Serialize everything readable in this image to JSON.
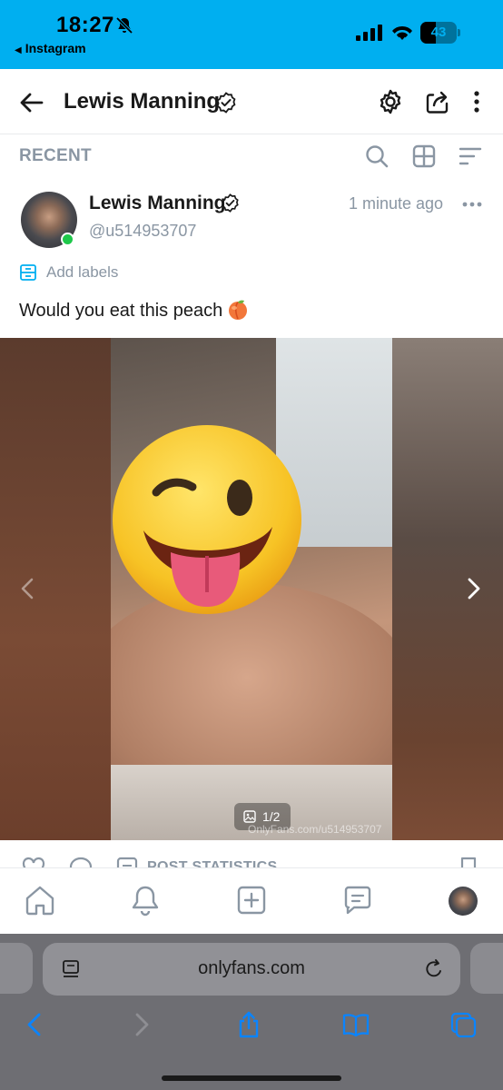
{
  "status_bar": {
    "time": "18:27",
    "back_app": "Instagram",
    "battery": "43",
    "battery_level": 0.43,
    "background": "#00aff0"
  },
  "header": {
    "title": "Lewis Manning",
    "icons": [
      "back-arrow-icon",
      "verified-icon",
      "gear-icon",
      "share-icon",
      "more-vertical-icon"
    ]
  },
  "recent_bar": {
    "label": "RECENT",
    "icons": [
      "search-icon",
      "grid-icon",
      "sort-icon"
    ]
  },
  "post": {
    "author_name": "Lewis Manning",
    "handle": "@u514953707",
    "time": "1 minute ago",
    "labels_action": "Add labels",
    "text": "Would you eat this peach",
    "emoji": "peach-emoji",
    "online": true,
    "media": {
      "counter": "1/2",
      "watermark": "OnlyFans.com/u514953707"
    },
    "actions": {
      "stats_label": "POST STATISTICS"
    }
  },
  "bottom_nav": {
    "items": [
      "home-icon",
      "notifications-icon",
      "add-post-icon",
      "messages-icon",
      "profile-avatar"
    ]
  },
  "safari": {
    "url": "onlyfans.com",
    "toolbar": [
      "back-icon",
      "forward-icon",
      "share-icon",
      "bookmarks-icon",
      "tabs-icon"
    ]
  },
  "colors": {
    "brand": "#00aff0",
    "muted": "#8a96a3",
    "online": "#1ec84a",
    "safari_blue": "#0a84ff"
  }
}
